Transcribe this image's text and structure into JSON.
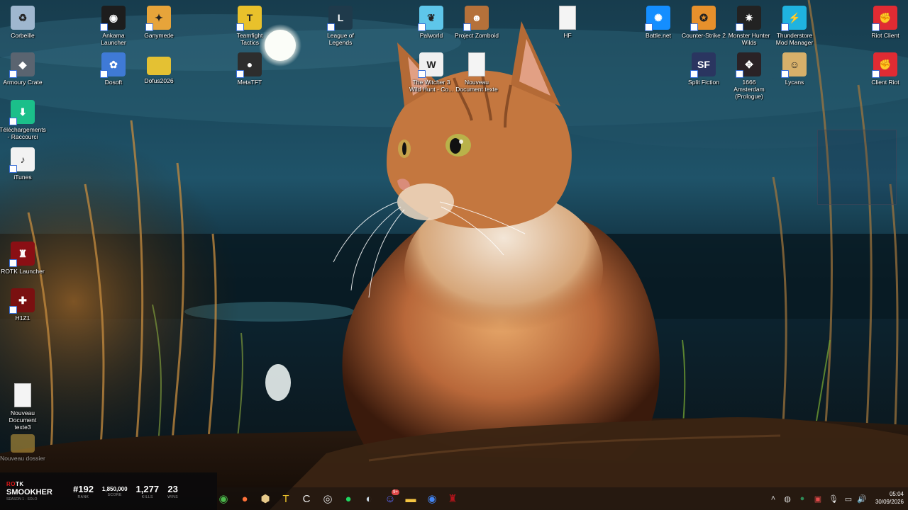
{
  "desktop": {
    "icons": [
      {
        "id": "corbeille",
        "label": "Corbeille",
        "icon": "recycle-bin-icon",
        "color": "#9fb7cf"
      },
      {
        "id": "armoury",
        "label": "Armoury Crate",
        "icon": "armoury-crate-icon",
        "color": "#5a6470"
      },
      {
        "id": "telechargements",
        "label": "Téléchargements - Raccourci",
        "icon": "downloads-folder-icon",
        "color": "#1bbf8a"
      },
      {
        "id": "itunes",
        "label": "iTunes",
        "icon": "itunes-icon",
        "color": "#f2f2f2"
      },
      {
        "id": "rotk",
        "label": "ROTK Launcher",
        "icon": "rotk-launcher-icon",
        "color": "#8a0f14"
      },
      {
        "id": "h1z1",
        "label": "H1Z1",
        "icon": "h1z1-icon",
        "color": "#7a1010"
      },
      {
        "id": "nouveau3",
        "label": "Nouveau Document texte3",
        "icon": "text-document-icon",
        "color": "#f4f4f4"
      },
      {
        "id": "nouveaudossier",
        "label": "Nouveau dossier",
        "icon": "folder-icon",
        "color": "#cfa640"
      },
      {
        "id": "ankama",
        "label": "Ankama Launcher",
        "icon": "ankama-icon",
        "color": "#1d1d1d"
      },
      {
        "id": "ganymede",
        "label": "Ganymede",
        "icon": "ganymede-icon",
        "color": "#e7a43a"
      },
      {
        "id": "dosoft",
        "label": "Dosoft",
        "icon": "dosoft-icon",
        "color": "#3f7ad6"
      },
      {
        "id": "dofus2026",
        "label": "Dofus2026",
        "icon": "folder-icon",
        "color": "#e4c133"
      },
      {
        "id": "teamfight",
        "label": "Teamfight Tactics",
        "icon": "tft-icon",
        "color": "#e9c12b"
      },
      {
        "id": "metatft",
        "label": "MetaTFT",
        "icon": "metatft-icon",
        "color": "#2d2d2d"
      },
      {
        "id": "lol",
        "label": "League of Legends",
        "icon": "league-icon",
        "color": "#1f3a4b"
      },
      {
        "id": "palworld",
        "label": "Palworld",
        "icon": "palworld-icon",
        "color": "#5ec6ea"
      },
      {
        "id": "witcher",
        "label": "The Witcher 3 Wild Hunt - Co...",
        "icon": "witcher-icon",
        "color": "#f0f0f0"
      },
      {
        "id": "zomboid",
        "label": "Project Zomboid",
        "icon": "zomboid-icon",
        "color": "#b5713a"
      },
      {
        "id": "nouveau",
        "label": "Nouveau Document texte",
        "icon": "text-document-icon",
        "color": "#f4f4f4"
      },
      {
        "id": "hf",
        "label": "HF",
        "icon": "text-document-icon",
        "color": "#f4f4f4"
      },
      {
        "id": "battlenet",
        "label": "Battle.net",
        "icon": "battlenet-icon",
        "color": "#148eff"
      },
      {
        "id": "cs2",
        "label": "Counter-Strike 2",
        "icon": "cs2-icon",
        "color": "#e6902c"
      },
      {
        "id": "mhw",
        "label": "Monster Hunter Wilds",
        "icon": "mhw-icon",
        "color": "#222"
      },
      {
        "id": "thunderstore",
        "label": "Thunderstore Mod Manager",
        "icon": "thunderstore-icon",
        "color": "#1fb3e0"
      },
      {
        "id": "splitfiction",
        "label": "Split Fiction",
        "icon": "split-fiction-icon",
        "color": "#2a3560"
      },
      {
        "id": "amsterdam",
        "label": "1666 Amsterdam (Prologue)",
        "icon": "amsterdam-icon",
        "color": "#2a2226"
      },
      {
        "id": "lycans",
        "label": "Lycans",
        "icon": "lycans-icon",
        "color": "#d7b06a"
      },
      {
        "id": "riotclient",
        "label": "Riot Client",
        "icon": "riot-client-icon",
        "color": "#e02b33"
      },
      {
        "id": "clientriot",
        "label": "Client Riot",
        "icon": "riot-client-icon",
        "color": "#e02b33"
      }
    ]
  },
  "overlay": {
    "brand_top_a": "RO",
    "brand_top_b": "TK",
    "player": "SMOOKHER",
    "season": "SEASON 1 · SOLO",
    "stats": [
      {
        "value": "#192",
        "key": "RANK"
      },
      {
        "value": "1,850,000",
        "key": "SCORE"
      },
      {
        "value": "1,277",
        "key": "KILLS"
      },
      {
        "value": "23",
        "key": "WINS"
      }
    ]
  },
  "taskbar": {
    "apps": [
      {
        "id": "tb-xbox",
        "icon": "xbox-app-icon",
        "color": "#4bb84b"
      },
      {
        "id": "tb-firefox",
        "icon": "firefox-icon",
        "color": "#ff7139"
      },
      {
        "id": "tb-hex",
        "icon": "hex-app-icon",
        "color": "#e6c98a"
      },
      {
        "id": "tb-tft",
        "icon": "tft-icon",
        "color": "#e9c12b"
      },
      {
        "id": "tb-ccleaner",
        "icon": "ccleaner-icon",
        "color": "#e8e8e8"
      },
      {
        "id": "tb-obs",
        "icon": "obs-icon",
        "color": "#dddddd"
      },
      {
        "id": "tb-spotify",
        "icon": "spotify-icon",
        "color": "#1ed760"
      },
      {
        "id": "tb-steam",
        "icon": "steam-icon",
        "color": "#c7d5e0"
      },
      {
        "id": "tb-discord",
        "icon": "discord-icon",
        "color": "#5865f2",
        "badge": "9+"
      },
      {
        "id": "tb-explorer",
        "icon": "file-explorer-icon",
        "color": "#f5c542"
      },
      {
        "id": "tb-chrome",
        "icon": "chrome-icon",
        "color": "#4285f4"
      },
      {
        "id": "tb-rotk",
        "icon": "rotk-launcher-icon",
        "color": "#b2141b"
      }
    ],
    "tray": [
      {
        "id": "tray-chevron",
        "icon": "chevron-up-icon"
      },
      {
        "id": "tray-app1",
        "icon": "app-tray-icon"
      },
      {
        "id": "tray-app2",
        "icon": "nvidia-tray-icon"
      },
      {
        "id": "tray-app3",
        "icon": "app-tray-icon-2"
      },
      {
        "id": "tray-mic",
        "icon": "microphone-icon"
      },
      {
        "id": "tray-monitor",
        "icon": "monitor-icon"
      },
      {
        "id": "tray-volume",
        "icon": "volume-icon"
      }
    ],
    "time": "05:04",
    "date": "30/09/2026"
  }
}
